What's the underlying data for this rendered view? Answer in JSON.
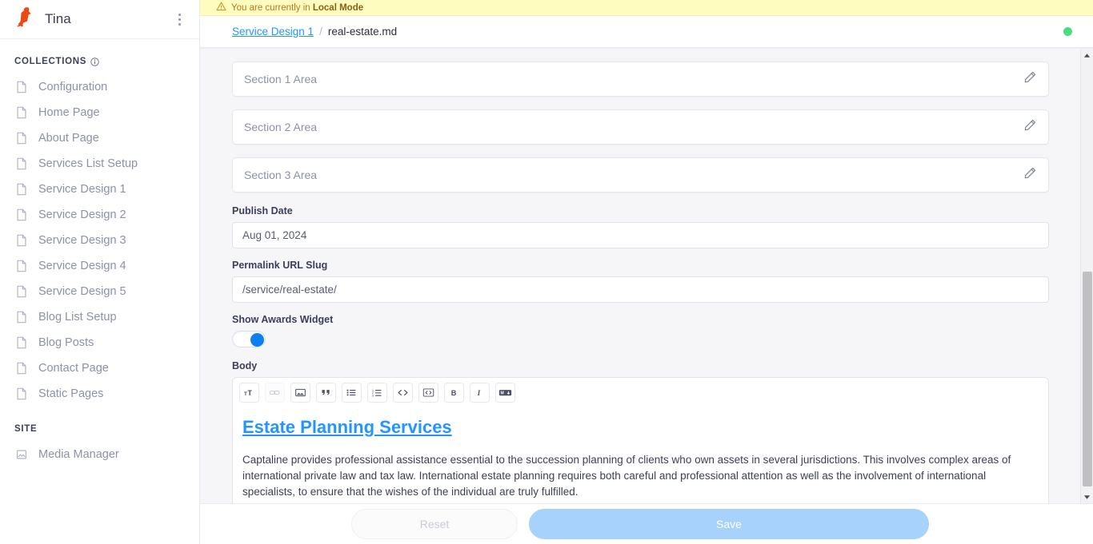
{
  "sidebar": {
    "brand": {
      "title": "Tina",
      "logo_icon": "tina-llama-logo",
      "menu_icon": "kebab-menu-icon"
    },
    "collections_label": "COLLECTIONS",
    "collections_info_icon": "info-icon",
    "items": [
      {
        "label": "Configuration",
        "icon": "page-icon"
      },
      {
        "label": "Home Page",
        "icon": "page-icon"
      },
      {
        "label": "About Page",
        "icon": "page-icon"
      },
      {
        "label": "Services List Setup",
        "icon": "page-icon"
      },
      {
        "label": "Service Design 1",
        "icon": "page-icon"
      },
      {
        "label": "Service Design 2",
        "icon": "page-icon"
      },
      {
        "label": "Service Design 3",
        "icon": "page-icon"
      },
      {
        "label": "Service Design 4",
        "icon": "page-icon"
      },
      {
        "label": "Service Design 5",
        "icon": "page-icon"
      },
      {
        "label": "Blog List Setup",
        "icon": "page-icon"
      },
      {
        "label": "Blog Posts",
        "icon": "page-icon"
      },
      {
        "label": "Contact Page",
        "icon": "page-icon"
      },
      {
        "label": "Static Pages",
        "icon": "page-icon"
      }
    ],
    "site_label": "SITE",
    "site_items": [
      {
        "label": "Media Manager",
        "icon": "media-image-icon"
      }
    ]
  },
  "banner": {
    "icon": "warning-triangle-icon",
    "text_prefix": "You are currently in ",
    "mode": "Local Mode"
  },
  "breadcrumb": {
    "collection": "Service Design 1",
    "separator": "/",
    "document": "real-estate.md",
    "status_icon": "status-dot-green"
  },
  "form": {
    "groups": [
      {
        "label": "Section 1 Area",
        "icon": "pencil-edit-icon"
      },
      {
        "label": "Section 2 Area",
        "icon": "pencil-edit-icon"
      },
      {
        "label": "Section 3 Area",
        "icon": "pencil-edit-icon"
      }
    ],
    "publish_date": {
      "label": "Publish Date",
      "value": "Aug 01, 2024",
      "placeholder": "Publish Date"
    },
    "permalink": {
      "label": "Permalink URL Slug",
      "value": "/service/real-estate/",
      "placeholder": "Permalink URL Slug"
    },
    "awards_toggle": {
      "label": "Show Awards Widget",
      "state": "on"
    },
    "body": {
      "label": "Body",
      "toolbar": [
        {
          "name": "heading-icon",
          "title": "Heading"
        },
        {
          "name": "link-icon",
          "title": "Link"
        },
        {
          "name": "image-icon",
          "title": "Image"
        },
        {
          "name": "quote-icon",
          "title": "Quote"
        },
        {
          "name": "bulleted-list-icon",
          "title": "Bulleted List"
        },
        {
          "name": "numbered-list-icon",
          "title": "Numbered List"
        },
        {
          "name": "inline-code-icon",
          "title": "Code"
        },
        {
          "name": "code-block-icon",
          "title": "Code Block"
        },
        {
          "name": "bold-icon",
          "title": "Bold"
        },
        {
          "name": "italic-icon",
          "title": "Italic"
        },
        {
          "name": "markdown-icon",
          "title": "Raw Markdown"
        }
      ],
      "heading": "Estate Planning Services",
      "paragraph": "Captaline provides professional assistance essential to the succession planning of clients who own assets in several jurisdictions. This involves complex areas of international private law and tax law. International estate planning requires both careful and professional attention as well as the involvement of international specialists, to ensure that the wishes of the individual are truly fulfilled."
    }
  },
  "actions": {
    "reset_label": "Reset",
    "save_label": "Save"
  },
  "colors": {
    "brand_orange": "#ec4815",
    "link_blue": "#2296fe",
    "toggle_blue": "#0c7ff2",
    "save_blue": "#a6d2fb",
    "status_green": "#4ade80",
    "banner_bg": "#fefcbf",
    "banner_text": "#b7791f"
  }
}
